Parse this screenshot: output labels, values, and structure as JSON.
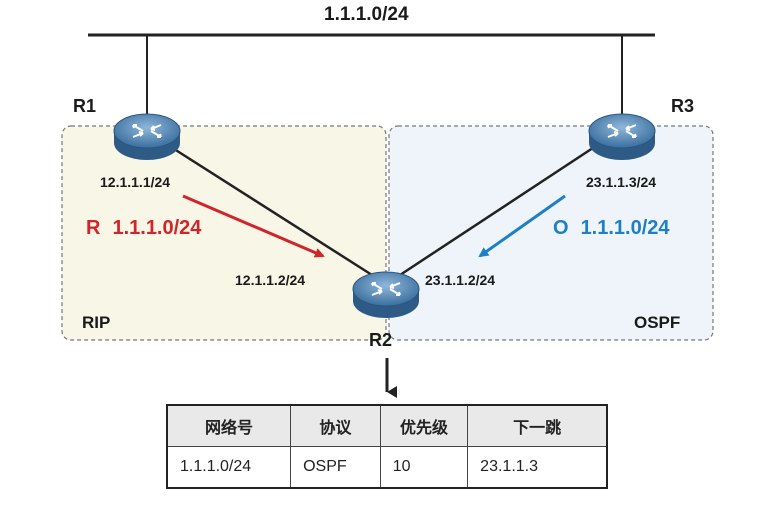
{
  "network_label": "1.1.1.0/24",
  "routers": {
    "r1": "R1",
    "r2": "R2",
    "r3": "R3"
  },
  "zones": {
    "rip": "RIP",
    "ospf": "OSPF"
  },
  "interfaces": {
    "r1_r2": "12.1.1.1/24",
    "r2_r1": "12.1.1.2/24",
    "r3_r2": "23.1.1.3/24",
    "r2_r3": "23.1.1.2/24"
  },
  "routes": {
    "rip": {
      "code": "R",
      "prefix": "1.1.1.0/24"
    },
    "ospf": {
      "code": "O",
      "prefix": "1.1.1.0/24"
    }
  },
  "colors": {
    "rip": "#d0252b",
    "ospf": "#1f7fc4",
    "rip_zone_bg": "#f8f6e6",
    "ospf_zone_bg": "#eef4fa"
  },
  "routing_table": {
    "headers": [
      "网络号",
      "协议",
      "优先级",
      "下一跳"
    ],
    "rows": [
      [
        "1.1.1.0/24",
        "OSPF",
        "10",
        "23.1.1.3"
      ]
    ]
  }
}
